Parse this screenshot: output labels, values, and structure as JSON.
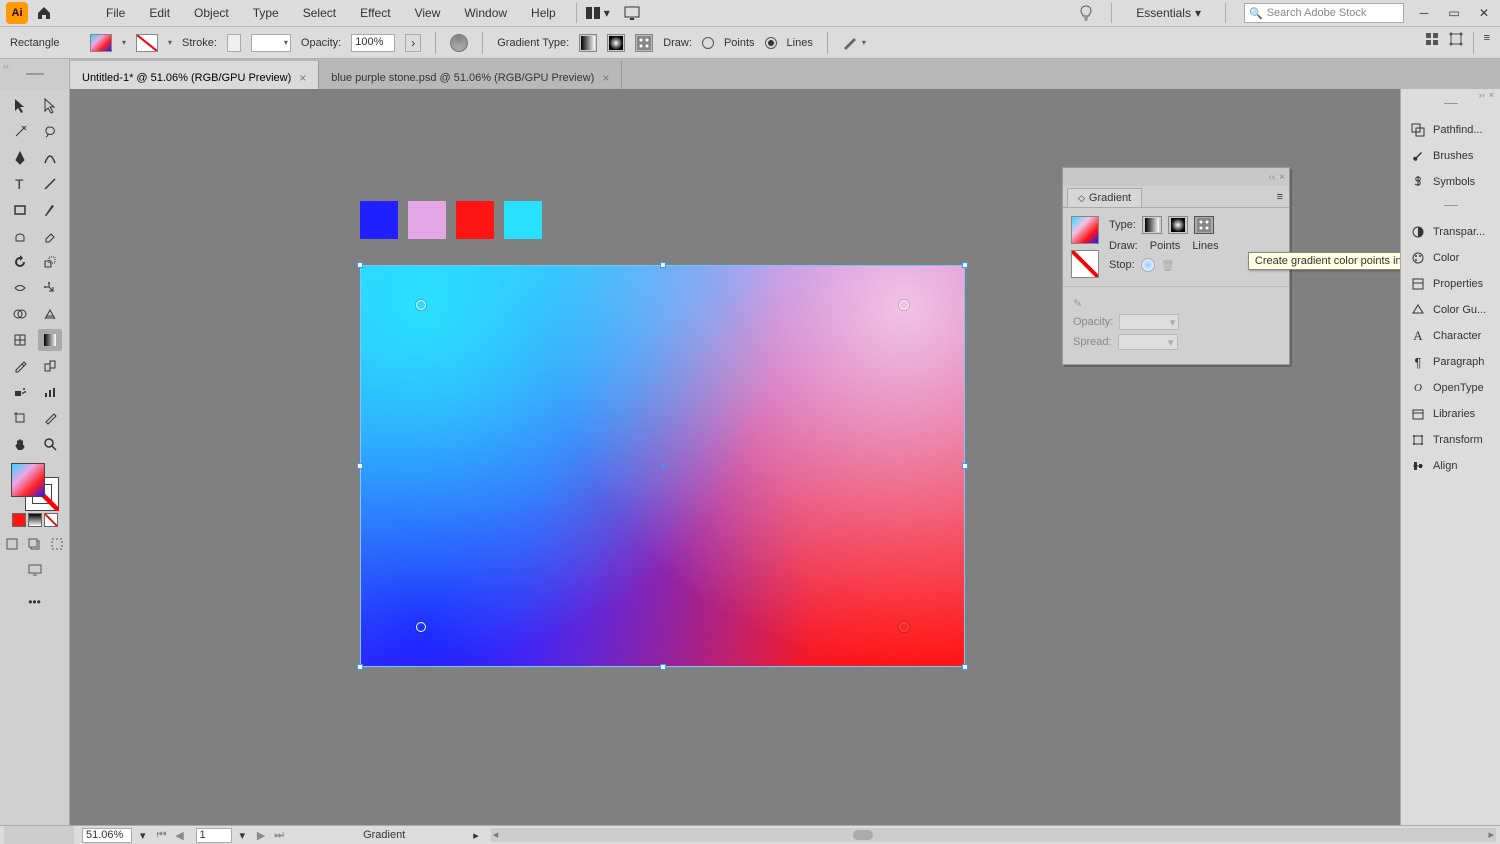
{
  "menubar": {
    "logo": "Ai",
    "items": [
      "File",
      "Edit",
      "Object",
      "Type",
      "Select",
      "Effect",
      "View",
      "Window",
      "Help"
    ],
    "workspace": "Essentials",
    "search_placeholder": "Search Adobe Stock"
  },
  "controlbar": {
    "shape": "Rectangle",
    "stroke_label": "Stroke:",
    "opacity_label": "Opacity:",
    "opacity_value": "100%",
    "gradient_type_label": "Gradient Type:",
    "draw_label": "Draw:",
    "points_label": "Points",
    "lines_label": "Lines",
    "draw_mode": "lines"
  },
  "tabs": [
    {
      "label": "Untitled-1* @ 51.06% (RGB/GPU Preview)",
      "active": true
    },
    {
      "label": "blue purple stone.psd @ 51.06% (RGB/GPU Preview)",
      "active": false
    }
  ],
  "swatches": [
    "#1f1fff",
    "#e3a7e5",
    "#ff1414",
    "#29e1ff"
  ],
  "right_panels": [
    "Pathfind...",
    "Brushes",
    "Symbols",
    "",
    "Transpar...",
    "Color",
    "Properties",
    "Color Gu...",
    "Character",
    "Paragraph",
    "OpenType",
    "Libraries",
    "Transform",
    "Align"
  ],
  "gradient_panel": {
    "title": "Gradient",
    "type_label": "Type:",
    "draw_label": "Draw:",
    "points_label": "Points",
    "lines_label": "Lines",
    "stop_label": "Stop:",
    "opacity_label": "Opacity:",
    "spread_label": "Spread:"
  },
  "tooltip": "Create gradient color points in a line",
  "statusbar": {
    "zoom": "51.06%",
    "page": "1",
    "tool": "Gradient"
  }
}
